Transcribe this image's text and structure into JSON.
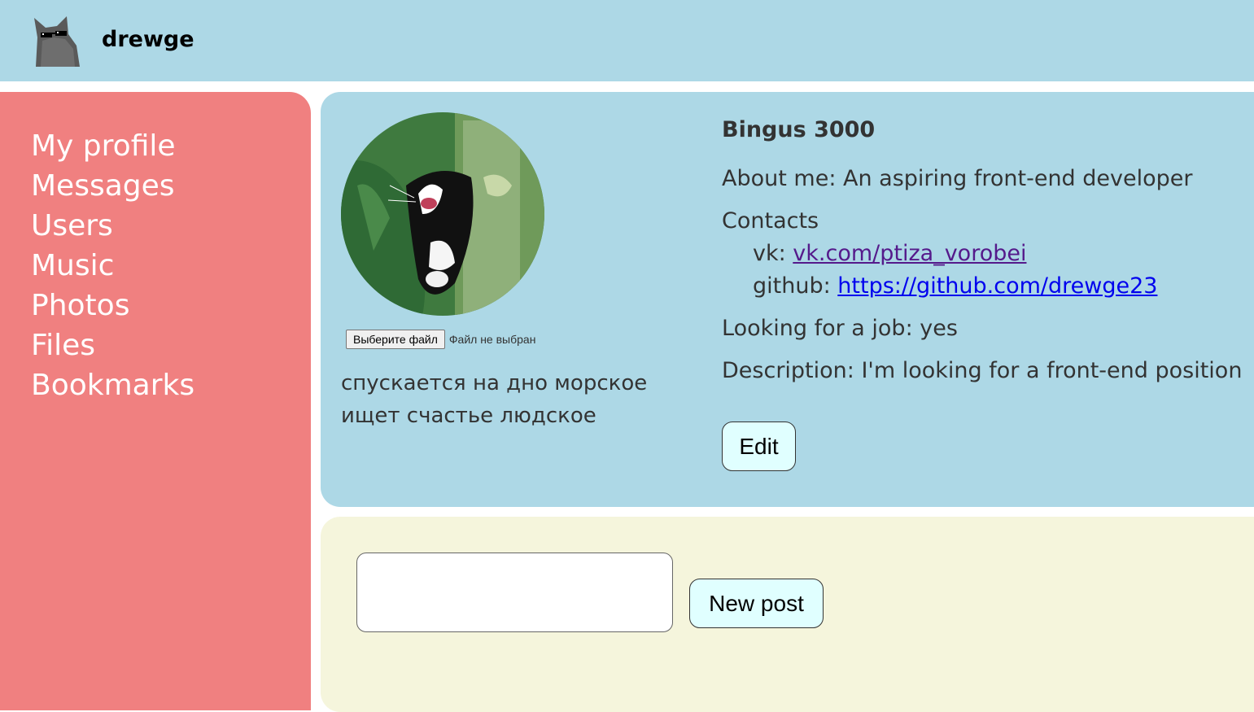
{
  "header": {
    "logo_icon": "cat-with-sunglasses-icon",
    "title": "drewge"
  },
  "sidebar": {
    "items": [
      {
        "label": "My profile"
      },
      {
        "label": "Messages"
      },
      {
        "label": "Users"
      },
      {
        "label": "Music"
      },
      {
        "label": "Photos"
      },
      {
        "label": "Files"
      },
      {
        "label": "Bookmarks"
      }
    ]
  },
  "profile": {
    "avatar_icon": "cat-photo-avatar",
    "file_input": {
      "button_label": "Выберите файл",
      "status_text": "Файл не выбран"
    },
    "status_text": "спускается на дно морское\nищет счастье людское",
    "full_name": "Bingus 3000",
    "about_me": "About me: An aspiring front-end developer",
    "contacts_title": "Contacts",
    "contacts": [
      {
        "label": "vk: ",
        "link": "vk.com/ptiza_vorobei"
      },
      {
        "label": "github: ",
        "link": "https://github.com/drewge23"
      }
    ],
    "looking_for_job": "Looking for a job: yes",
    "description": "Description: I'm looking for a front-end position",
    "edit_label": "Edit"
  },
  "posts": {
    "input_value": "",
    "new_post_label": "New post"
  },
  "colors": {
    "header_bg": "#add8e6",
    "sidebar_bg": "#f08080",
    "profile_bg": "#add8e6",
    "posts_bg": "#f5f5dc",
    "button_bg": "#e0ffff"
  }
}
